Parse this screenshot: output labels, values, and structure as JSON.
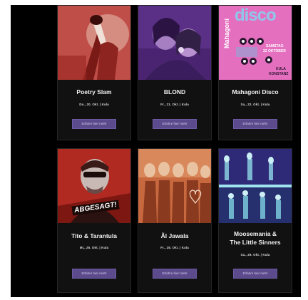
{
  "events": [
    {
      "title": "Poetry Slam",
      "date": "Do., 20. Okt. | Kula",
      "button": "Erfahre hier mehr"
    },
    {
      "title": "BLOND",
      "date": "Fr., 21. Okt. | Kula",
      "button": "Erfahre hier mehr"
    },
    {
      "title": "Mahagoni Disco",
      "date": "Sa., 22. Okt. | Kula",
      "button": "Erfahre hier mehr",
      "poster": {
        "vertical": "Mahagoni",
        "big": "disco",
        "line1": "SAMSTAG",
        "line2": "22 OKTOBER",
        "place1": "KULA",
        "place2": "KONSTANZ"
      }
    },
    {
      "title": "Tito & Tarantula",
      "date": "Mi., 26. Okt. | Kula",
      "button": "Erfahre hier mehr",
      "banner": "ABGESAGT!"
    },
    {
      "title": "Ãl Jawala",
      "date": "Fr., 28. Okt. | Kula",
      "button": "Erfahre hier mehr"
    },
    {
      "title_line1": "Moosemania &",
      "title_line2": "The Little Sinners",
      "date": "Sa., 29. Okt. | Kula",
      "button": "Erfahre hier mehr"
    }
  ],
  "colors": {
    "accent": "#5b4a8c",
    "background": "#000000",
    "card": "#111111"
  }
}
